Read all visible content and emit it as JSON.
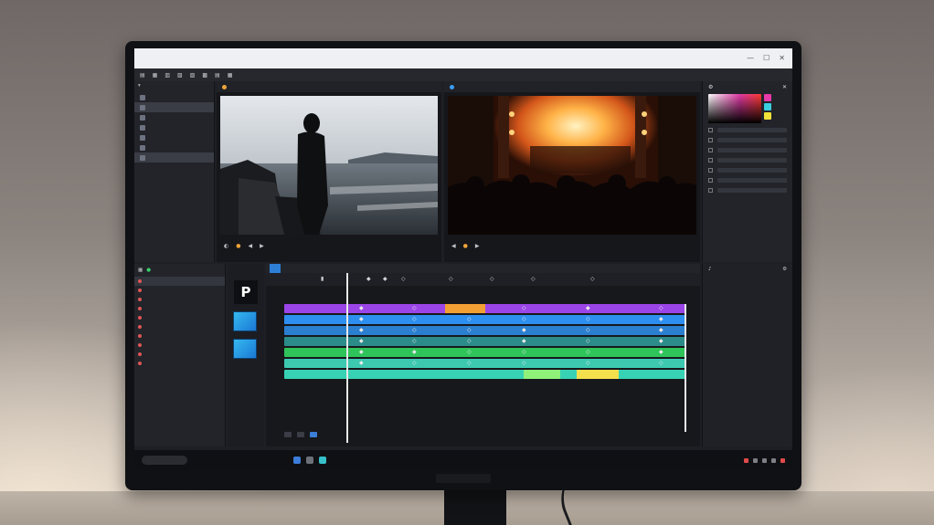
{
  "colors": {
    "accent": "#2d7fd6",
    "track_purple": "#8d3be0",
    "track_blue": "#2a8fe8",
    "track_cyan": "#2fb0d8",
    "track_green": "#2fc46a",
    "track_teal": "#36d8b0",
    "clip_orange": "#f2a033",
    "clip_yellow": "#f4e04d",
    "clip_lime": "#8ff07a"
  },
  "program_monitor": {
    "play_icon": "play-icon"
  },
  "media_strip": {
    "p_label": "P"
  },
  "timeline": {
    "ruler_ticks": [
      "▮",
      "◆",
      "◆",
      "◇",
      "◇",
      "◇",
      "◇",
      "◇"
    ],
    "tracks": [
      {
        "color": "#9b45e8",
        "keyframes": [
          "◆",
          "◇",
          "◇",
          "◇",
          "◆",
          "◇"
        ]
      },
      {
        "color": "#2d8ff0",
        "keyframes": [
          "◆",
          "◇",
          "◇",
          "◇",
          "◇",
          "◆"
        ]
      },
      {
        "color": "#2a7fd0",
        "keyframes": [
          "◆",
          "◇",
          "◇",
          "◆",
          "◇",
          "◆"
        ]
      },
      {
        "color": "#2b8c8a",
        "keyframes": [
          "◆",
          "◇",
          "◇",
          "◆",
          "◇",
          "◆"
        ]
      },
      {
        "color": "#2fc45a",
        "keyframes": [
          "◆",
          "◆",
          "◇",
          "◇",
          "◇",
          "◆"
        ]
      },
      {
        "color": "#3cc9b0",
        "keyframes": [
          "◆",
          "◇",
          "◇",
          "◇",
          "◇",
          "◇"
        ]
      },
      {
        "color": "#37d2b4",
        "keyframes": []
      }
    ]
  },
  "window_controls": [
    "—",
    "☐",
    "✕"
  ]
}
